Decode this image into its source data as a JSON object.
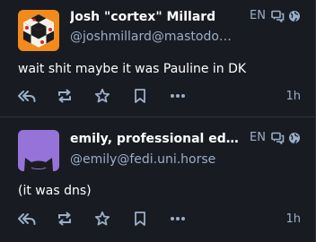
{
  "colors": {
    "background": "#191b22",
    "divider": "#2f3340",
    "text_primary": "#ffffff",
    "text_secondary": "#9baec8",
    "avatar_1_orange": "#f28a1c",
    "avatar_2_purple": "#9673d9"
  },
  "posts": [
    {
      "display_name": "Josh \"cortex\" Millard",
      "handle": "@joshmillard@mastodon....",
      "language": "EN",
      "content": "wait shit maybe it was Pauline in DK",
      "timestamp": "1h",
      "avatar_icon": "cube-logo-avatar",
      "visibility_icon": "globe-icon",
      "thread_icon": "replies-icon"
    },
    {
      "display_name": "emily, professional edge c...",
      "handle": "@emily@fedi.uni.horse",
      "language": "EN",
      "content": "(it was dns)",
      "timestamp": "1h",
      "avatar_icon": "cat-silhouette-avatar",
      "visibility_icon": "globe-icon",
      "thread_icon": "replies-icon"
    }
  ],
  "actions": [
    "reply-all-icon",
    "boost-icon",
    "favourite-icon",
    "bookmark-icon",
    "more-icon"
  ]
}
